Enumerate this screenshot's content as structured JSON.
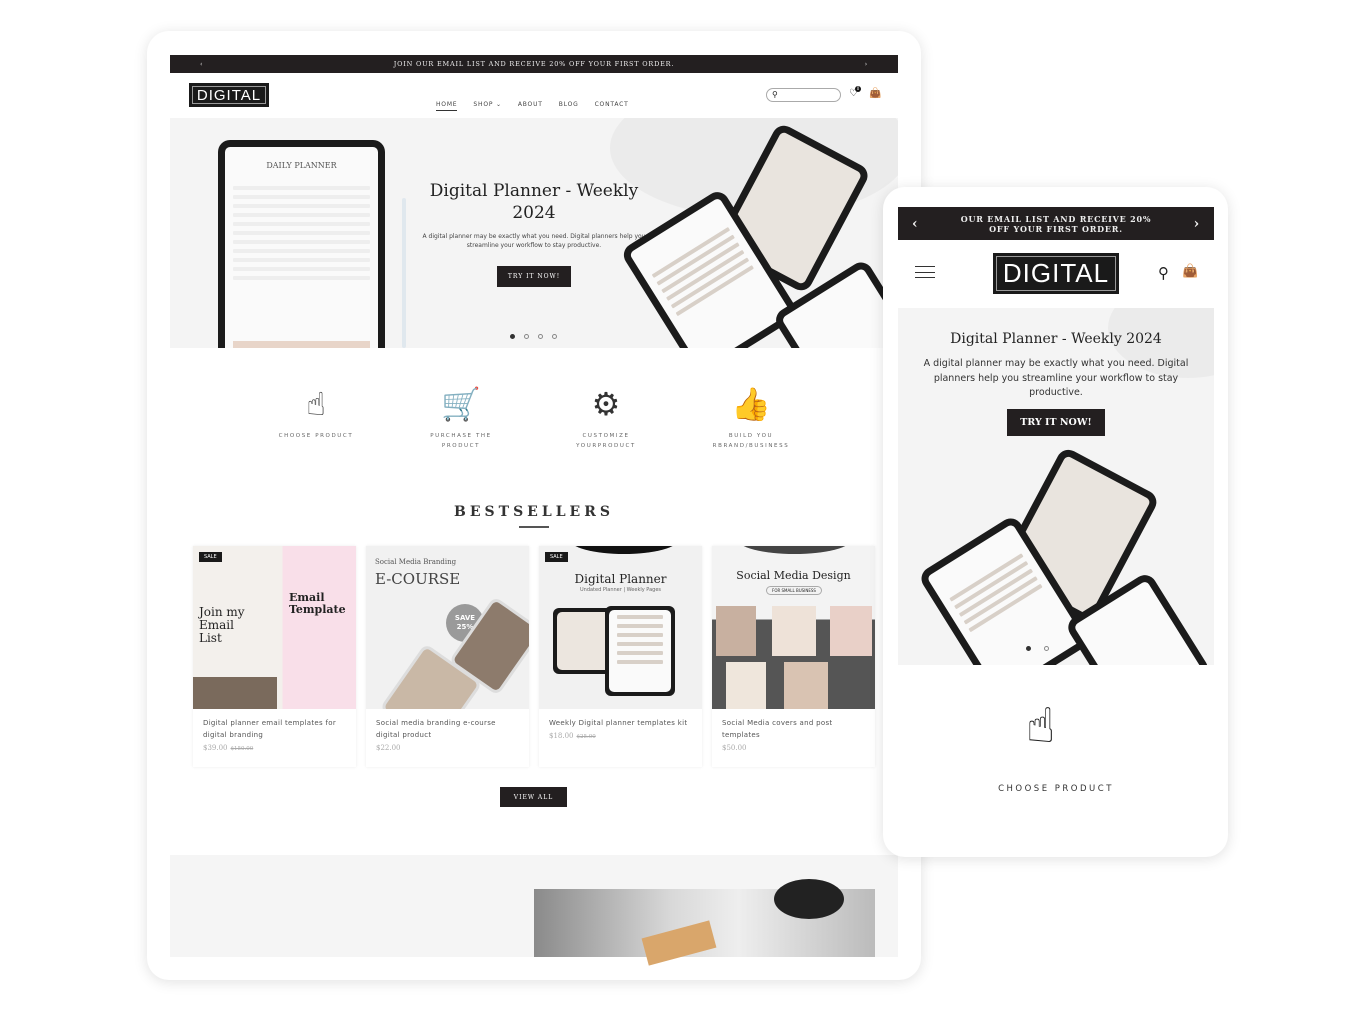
{
  "desktop": {
    "announcement": "JOIN OUR EMAIL LIST AND RECEIVE 20% OFF YOUR FIRST ORDER.",
    "logo": "DIGITAL",
    "nav": [
      "HOME",
      "SHOP",
      "ABOUT",
      "BLOG",
      "CONTACT"
    ],
    "wishlist_count": "0",
    "hero": {
      "title": "Digital Planner - Weekly 2024",
      "text": "A digital planner may be exactly what you need. Digital planners help you streamline your workflow to stay productive.",
      "button": "TRY IT NOW!",
      "planner_title": "DAILY PLANNER",
      "slides": 4,
      "active_slide": 1
    },
    "steps": [
      {
        "icon": "touch-screen-icon",
        "label": "CHOOSE PRODUCT"
      },
      {
        "icon": "cart-dollar-icon",
        "label": "PURCHASE THE PRODUCT"
      },
      {
        "icon": "gear-hand-icon",
        "label": "CUSTOMIZE YOURPRODUCT"
      },
      {
        "icon": "thumbs-up-star-icon",
        "label": "BUILD YOU RBRAND/BUSINESS"
      }
    ],
    "bestsellers_title": "BESTSELLERS",
    "products": [
      {
        "badge": "SALE",
        "img_title": "Email Template",
        "img_sub": "Join my Email List",
        "title": "Digital planner email templates for digital branding",
        "price": "$39.00",
        "old_price": "$150.00"
      },
      {
        "badge": "",
        "img_title": "E-COURSE",
        "img_sub": "Social Media Branding",
        "img_badge": "SAVE 25%",
        "title": "Social media branding e-course digital product",
        "price": "$22.00",
        "old_price": ""
      },
      {
        "badge": "SALE",
        "img_title": "Digital Planner",
        "img_sub": "Undated Planner | Weekly Pages",
        "title": "Weekly Digital planner templates kit",
        "price": "$18.00",
        "old_price": "$25.00"
      },
      {
        "badge": "",
        "img_title": "Social Media Design",
        "img_sub": "FOR SMALL BUSINESS",
        "title": "Social Media covers and post templates",
        "price": "$50.00",
        "old_price": ""
      }
    ],
    "view_all": "VIEW ALL"
  },
  "mobile": {
    "announcement": "OUR EMAIL LIST AND RECEIVE 20% OFF YOUR FIRST ORDER.",
    "logo": "DIGITAL",
    "hero": {
      "title": "Digital Planner - Weekly 2024",
      "text": "A digital planner may be exactly what you need. Digital planners help you streamline your workflow to stay productive.",
      "button": "TRY IT NOW!"
    },
    "step_label": "CHOOSE PRODUCT"
  }
}
